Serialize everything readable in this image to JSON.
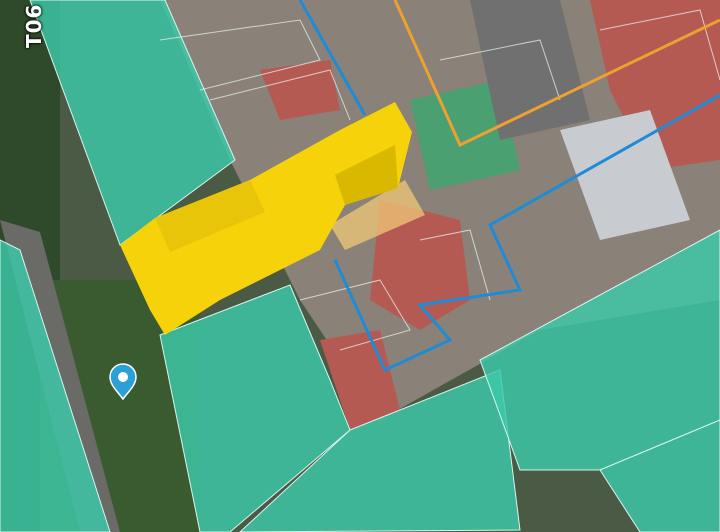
{
  "map": {
    "street_label": "T06",
    "colors": {
      "parcel_fill": "#3cc9a8",
      "parcel_outline": "#d8f5ee",
      "building_extrusion": "#f5d20a",
      "building_extrusion_shade": "#d9b800",
      "selected_parcel": "#f0c878",
      "boundary_blue": "#1f8ad6",
      "boundary_orange": "#f0a030",
      "marker": "#2a9fd8"
    },
    "icons": {
      "location_marker": "map-pin-icon"
    }
  }
}
